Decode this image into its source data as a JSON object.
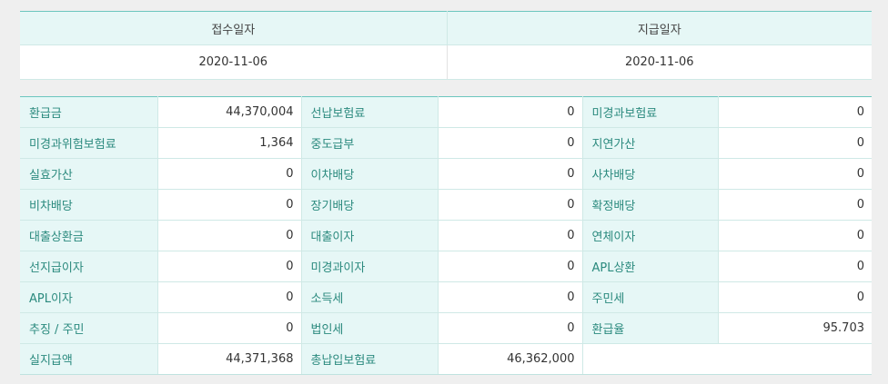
{
  "summary": {
    "headers": [
      "접수일자",
      "지급일자"
    ],
    "values": [
      "2020-11-06",
      "2020-11-06"
    ]
  },
  "details": {
    "rows": [
      [
        [
          "환급금",
          "44,370,004"
        ],
        [
          "선납보험료",
          "0"
        ],
        [
          "미경과보험료",
          "0"
        ]
      ],
      [
        [
          "미경과위험보험료",
          "1,364"
        ],
        [
          "중도급부",
          "0"
        ],
        [
          "지연가산",
          "0"
        ]
      ],
      [
        [
          "실효가산",
          "0"
        ],
        [
          "이차배당",
          "0"
        ],
        [
          "사차배당",
          "0"
        ]
      ],
      [
        [
          "비차배당",
          "0"
        ],
        [
          "장기배당",
          "0"
        ],
        [
          "확정배당",
          "0"
        ]
      ],
      [
        [
          "대출상환금",
          "0"
        ],
        [
          "대출이자",
          "0"
        ],
        [
          "연체이자",
          "0"
        ]
      ],
      [
        [
          "선지급이자",
          "0"
        ],
        [
          "미경과이자",
          "0"
        ],
        [
          "APL상환",
          "0"
        ]
      ],
      [
        [
          "APL이자",
          "0"
        ],
        [
          "소득세",
          "0"
        ],
        [
          "주민세",
          "0"
        ]
      ],
      [
        [
          "추징 / 주민",
          "0"
        ],
        [
          "법인세",
          "0"
        ],
        [
          "환급율",
          "95.703"
        ]
      ],
      [
        [
          "실지급액",
          "44,371,368"
        ],
        [
          "총납입보험료",
          "46,362,000"
        ],
        [
          "",
          ""
        ]
      ]
    ]
  }
}
